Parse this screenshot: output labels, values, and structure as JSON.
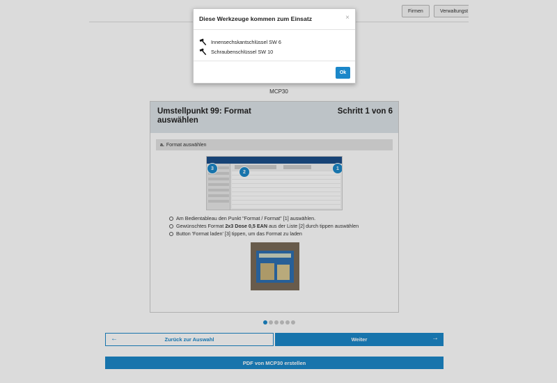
{
  "topbar": {
    "buttons": [
      "Firmen",
      "Verwaltungst"
    ]
  },
  "machine": "MCP30",
  "step": {
    "title": "Umstellpunkt 99: Format auswählen",
    "counter": "Schritt 1 von 6",
    "section_letter": "a.",
    "section_label": "Format auswählen",
    "callouts": [
      "3",
      "2",
      "1"
    ],
    "instructions": [
      {
        "pre": "Am Bedientableau den Punkt \"Format / Format\" [1] auswählen.",
        "bold": "",
        "post": ""
      },
      {
        "pre": "Gewünschtes Format ",
        "bold": "2x3 Dose 0,5 EAN",
        "post": " aus der Liste [2] durch tippen auswählen"
      },
      {
        "pre": "Button 'Format laden' [3] tippen, um das Format zu laden",
        "bold": "",
        "post": ""
      }
    ]
  },
  "pagination": {
    "total": 6,
    "active": 1
  },
  "nav": {
    "back_label": "Zurück zur Auswahl",
    "next_label": "Weiter",
    "pdf_label": "PDF von MCP30 erstellen",
    "back_icon": "arrow-left-icon",
    "next_icon": "arrow-right-icon"
  },
  "modal": {
    "title": "Diese Werkzeuge kommen zum Einsatz",
    "close_symbol": "×",
    "tools": [
      "Innensechskantschlüssel SW 6",
      "Schraubenschlüssel SW 10"
    ],
    "tool_icon": "hammer-icon",
    "ok_label": "Ok"
  },
  "colors": {
    "accent": "#1b87c9",
    "header_bg": "#dde3e8"
  }
}
